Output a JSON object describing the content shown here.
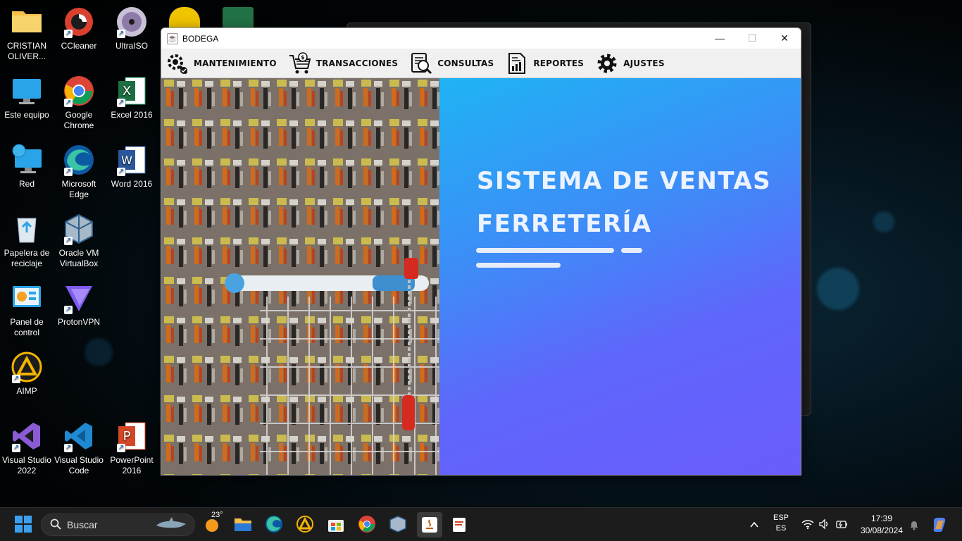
{
  "desktop": {
    "icons": [
      {
        "label": "CRISTIAN OLIVER..."
      },
      {
        "label": "CCleaner"
      },
      {
        "label": "UltraISO"
      },
      {
        "label": "Este equipo"
      },
      {
        "label": "Google Chrome"
      },
      {
        "label": "Excel 2016"
      },
      {
        "label": "Red"
      },
      {
        "label": "Microsoft Edge"
      },
      {
        "label": "Word 2016"
      },
      {
        "label": "Papelera de reciclaje"
      },
      {
        "label": "Oracle VM VirtualBox"
      },
      {
        "label": "Panel de control"
      },
      {
        "label": "ProtonVPN"
      },
      {
        "label": "AIMP"
      },
      {
        "label": "Visual Studio 2022"
      },
      {
        "label": "Visual Studio Code"
      },
      {
        "label": "PowerPoint 2016"
      }
    ]
  },
  "window": {
    "title": "BODEGA",
    "minimize": "—",
    "maximize": "☐",
    "close": "✕"
  },
  "menu": {
    "items": [
      {
        "label": "MANTENIMIENTO",
        "icon": "gear-wrench-icon"
      },
      {
        "label": "TRANSACCIONES",
        "icon": "cart-dollar-icon"
      },
      {
        "label": "CONSULTAS",
        "icon": "document-search-icon"
      },
      {
        "label": "REPORTES",
        "icon": "report-chart-icon"
      },
      {
        "label": "AJUSTES",
        "icon": "gear-icon"
      }
    ]
  },
  "hero": {
    "line1": "SISTEMA DE VENTAS",
    "line2": "FERRETERÍA",
    "gradient_start": "#1fb3f3",
    "gradient_end": "#6a5cfc"
  },
  "taskbar": {
    "search_placeholder": "Buscar",
    "weather_temp": "23°",
    "language_top": "ESP",
    "language_bottom": "ES",
    "time": "17:39",
    "date": "30/08/2024"
  }
}
